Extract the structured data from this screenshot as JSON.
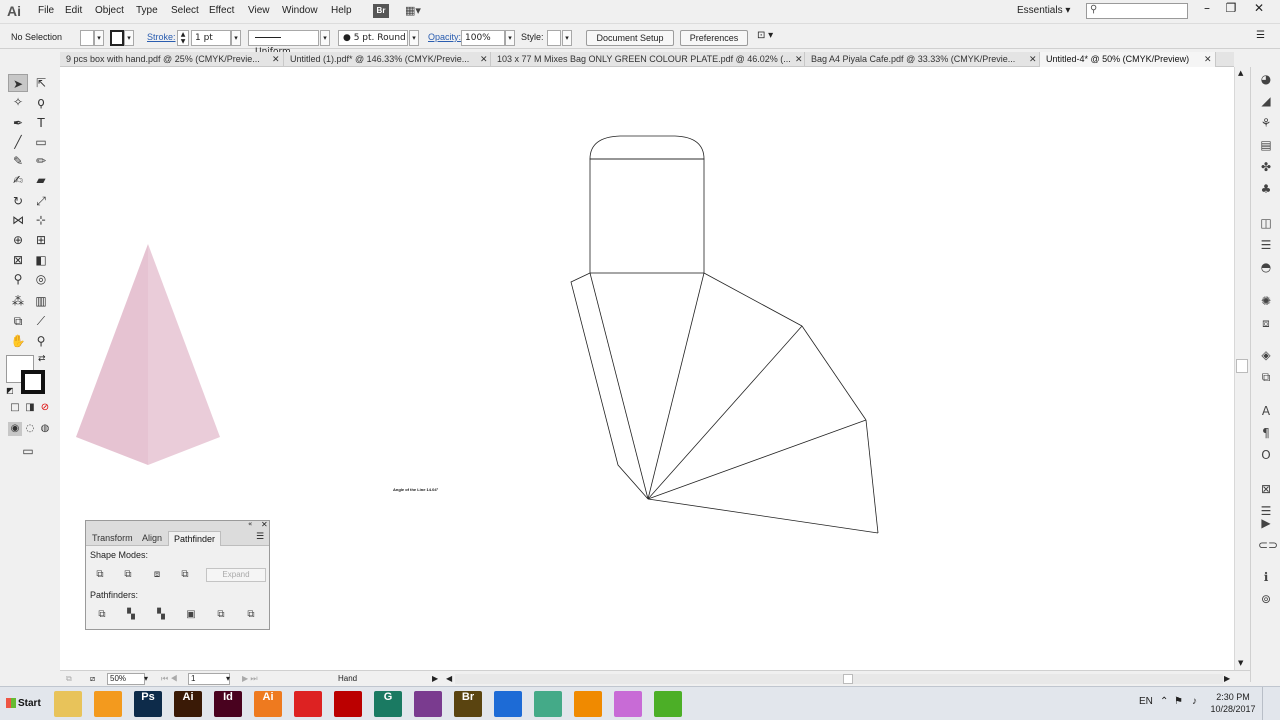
{
  "app": {
    "logo": "Ai",
    "menu": [
      "File",
      "Edit",
      "Object",
      "Type",
      "Select",
      "Effect",
      "View",
      "Window",
      "Help"
    ],
    "bridge_label": "Br",
    "workspace": "Essentials"
  },
  "control_bar": {
    "selection": "No Selection",
    "stroke_label": "Stroke:",
    "stroke_weight": "1 pt",
    "profile": "Uniform",
    "brush": "5 pt. Round",
    "opacity_label": "Opacity:",
    "opacity": "100%",
    "style_label": "Style:",
    "document_setup": "Document Setup",
    "preferences": "Preferences"
  },
  "tabs": [
    {
      "label": "9 pcs box with hand.pdf @ 25% (CMYK/Previe...",
      "active": false
    },
    {
      "label": "Untitled (1).pdf* @ 146.33% (CMYK/Previe...",
      "active": false
    },
    {
      "label": "103 x 77 M Mixes Bag ONLY GREEN COLOUR PLATE.pdf @ 46.02% (...",
      "active": false
    },
    {
      "label": "Bag A4 Piyala Cafe.pdf @ 33.33% (CMYK/Previe...",
      "active": false
    },
    {
      "label": "Untitled-4* @ 50% (CMYK/Preview)",
      "active": true
    }
  ],
  "canvas": {
    "annotation": "Angle of the Line 14.04°",
    "pyramid_color": "#e6c3d2"
  },
  "pathfinder": {
    "tabs": [
      "Transform",
      "Align",
      "Pathfinder"
    ],
    "shape_modes_label": "Shape Modes:",
    "pathfinders_label": "Pathfinders:",
    "expand_label": "Expand"
  },
  "status_bar": {
    "zoom": "50%",
    "page": "1",
    "tool": "Hand"
  },
  "taskbar": {
    "start": "Start",
    "apps": [
      {
        "icon": "folder-icon",
        "glyph": "",
        "color": "#e8c35a"
      },
      {
        "icon": "media-player-icon",
        "glyph": "",
        "color": "#f39a1e"
      },
      {
        "icon": "photoshop-icon",
        "glyph": "Ps",
        "color": "#0d2b4a"
      },
      {
        "icon": "illustrator-icon",
        "glyph": "Ai",
        "color": "#3a1a06"
      },
      {
        "icon": "indesign-icon",
        "glyph": "Id",
        "color": "#49021f"
      },
      {
        "icon": "illustrator-alt-icon",
        "glyph": "Ai",
        "color": "#ee7a1f"
      },
      {
        "icon": "acrobat-icon",
        "glyph": "",
        "color": "#d22"
      },
      {
        "icon": "acrobat-pro-icon",
        "glyph": "",
        "color": "#b00"
      },
      {
        "icon": "camtasia-icon",
        "glyph": "G",
        "color": "#1a7a62"
      },
      {
        "icon": "winrar-icon",
        "glyph": "",
        "color": "#7a3b8f"
      },
      {
        "icon": "bridge-icon",
        "glyph": "Br",
        "color": "#5a4410"
      },
      {
        "icon": "teamviewer-icon",
        "glyph": "",
        "color": "#1d6bd6"
      },
      {
        "icon": "chrome-icon",
        "glyph": "",
        "color": "#4a8"
      },
      {
        "icon": "vlc-icon",
        "glyph": "",
        "color": "#f08a00"
      },
      {
        "icon": "itunes-icon",
        "glyph": "",
        "color": "#c86bd6"
      },
      {
        "icon": "utorrent-icon",
        "glyph": "",
        "color": "#4caf27"
      }
    ],
    "language": "EN",
    "time": "2:30 PM",
    "date": "10/28/2017"
  }
}
